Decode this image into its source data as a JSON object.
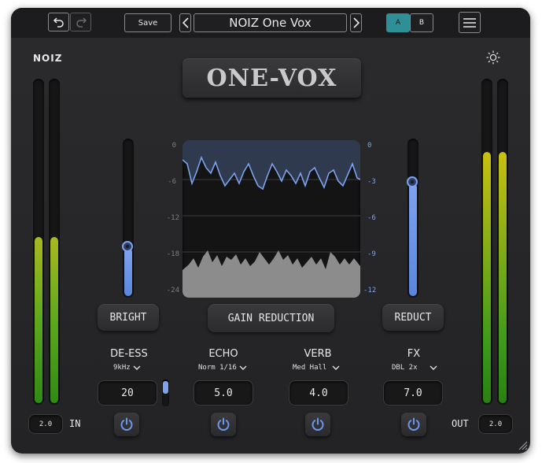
{
  "header": {
    "save_label": "Save",
    "preset_name": "NOIZ One Vox",
    "ab": [
      "A",
      "B"
    ]
  },
  "brand": {
    "logo": "NOIZ",
    "title": "ONE-VOX"
  },
  "meters": {
    "input_level": 0.52,
    "output_level": 0.78,
    "input_value": "2.0",
    "input_label": "IN",
    "output_value": "2.0",
    "output_label": "OUT"
  },
  "sliders": {
    "bright": {
      "label": "BRIGHT",
      "level": 0.32
    },
    "reduct": {
      "label": "REDUCT",
      "level": 0.73
    }
  },
  "gain_reduction": {
    "label": "GAIN REDUCTION",
    "left_scale": [
      "0",
      "-6",
      "-12",
      "-18",
      "-24"
    ],
    "right_scale": [
      "0",
      "-3",
      "-6",
      "-9",
      "-12"
    ]
  },
  "controls": [
    {
      "name": "DE-ESS",
      "option": "9kHz",
      "value": "20"
    },
    {
      "name": "ECHO",
      "option": "Norm 1/16",
      "value": "5.0"
    },
    {
      "name": "VERB",
      "option": "Med Hall",
      "value": "4.0"
    },
    {
      "name": "FX",
      "option": "DBL 2x",
      "value": "7.0"
    }
  ],
  "icons": [
    "undo-icon",
    "redo-icon",
    "prev-icon",
    "next-icon",
    "menu-icon",
    "brightness-icon",
    "power-icon",
    "chevron-down-icon",
    "resize-icon"
  ],
  "colors": {
    "accent_blue": "#6a98f0",
    "ab_active": "#2f8f96",
    "meter_green": "#3f9a1c",
    "meter_yellow": "#c8c010"
  }
}
